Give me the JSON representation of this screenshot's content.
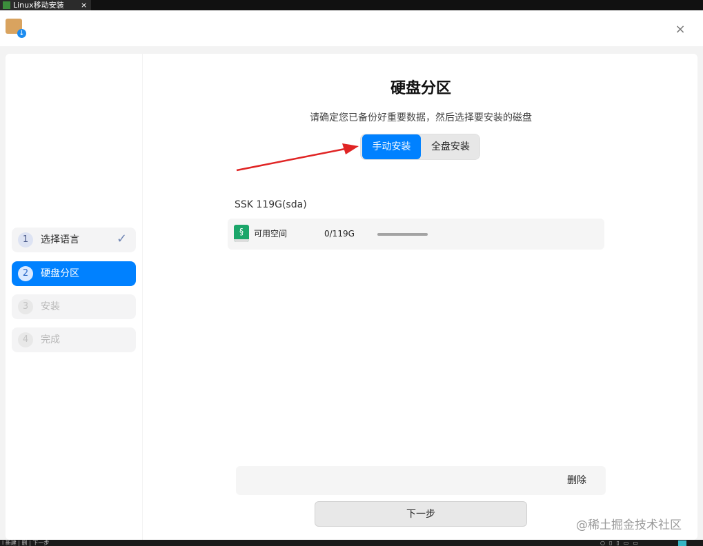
{
  "window": {
    "tab_title": "Linux移动安装",
    "tab_close": "×",
    "close_glyph": "×"
  },
  "steps": [
    {
      "number": "1",
      "label": "选择语言",
      "state": "done"
    },
    {
      "number": "2",
      "label": "硬盘分区",
      "state": "active"
    },
    {
      "number": "3",
      "label": "安装",
      "state": "pending"
    },
    {
      "number": "4",
      "label": "完成",
      "state": "pending"
    }
  ],
  "check_glyph": "✓",
  "main": {
    "title": "硬盘分区",
    "subtitle": "请确定您已备份好重要数据，然后选择要安装的磁盘",
    "modes": {
      "manual": "手动安装",
      "full": "全盘安装",
      "selected": "manual"
    }
  },
  "disk": {
    "label": "SSK  119G(sda)",
    "partitions": [
      {
        "name": "可用空间",
        "size": "0/119G",
        "usage_fraction": 1.0
      }
    ]
  },
  "actions": {
    "delete": "删除",
    "next": "下一步"
  },
  "watermark": "@稀土掘金技术社区",
  "taskbar": {
    "text": "l 新建 | 删 | 下一步"
  },
  "colors": {
    "accent": "#0081ff",
    "annotation_arrow": "#e02424",
    "partition_icon": "#1ba66a"
  },
  "icons": {
    "app": "package-download-icon",
    "partition": "linux-partition-icon",
    "close": "close-icon",
    "check": "check-icon"
  }
}
